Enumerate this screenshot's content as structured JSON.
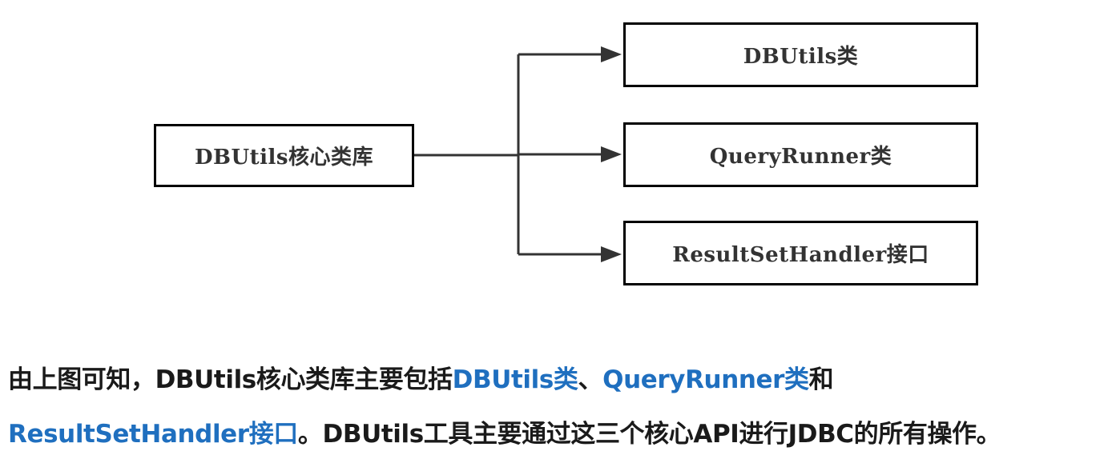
{
  "diagram": {
    "root": "DBUtils核心类库",
    "children": [
      "DBUtils类",
      "QueryRunner类",
      "ResultSetHandler接口"
    ]
  },
  "caption": {
    "line1": {
      "part1": "由上图可知，DBUtils核心类库主要包括",
      "hl1": "DBUtils类",
      "part2": "、",
      "hl2": "QueryRunner类",
      "part3": "和"
    },
    "line2": {
      "hl1": "ResultSetHandler接口",
      "part1": "。DBUtils工具主要通过这三个核心API进行JDBC的所有操作。"
    }
  },
  "colors": {
    "highlight": "#1f6fbf",
    "text": "#1a1a1a",
    "box_border": "#000000"
  }
}
